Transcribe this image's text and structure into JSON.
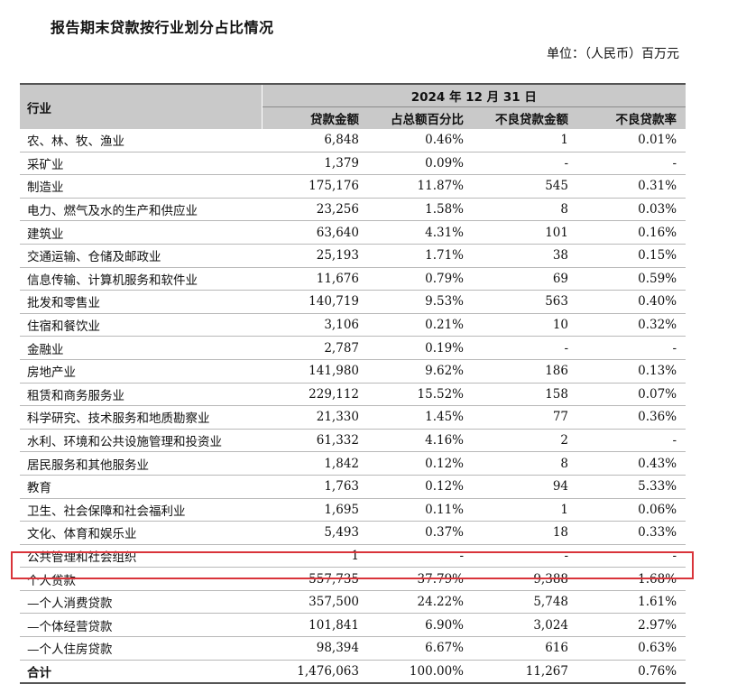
{
  "title": "报告期末贷款按行业划分占比情况",
  "unit": "单位：（人民币）百万元",
  "header": {
    "industry": "行业",
    "date": "2024 年 12 月 31 日",
    "columns": [
      "贷款金额",
      "占总额百分比",
      "不良贷款金额",
      "不良贷款率"
    ]
  },
  "rows": [
    {
      "name": "农、林、牧、渔业",
      "amount": "6,848",
      "pct": "0.46%",
      "npl": "1",
      "nplr": "0.01%"
    },
    {
      "name": "采矿业",
      "amount": "1,379",
      "pct": "0.09%",
      "npl": "-",
      "nplr": "-"
    },
    {
      "name": "制造业",
      "amount": "175,176",
      "pct": "11.87%",
      "npl": "545",
      "nplr": "0.31%"
    },
    {
      "name": "电力、燃气及水的生产和供应业",
      "amount": "23,256",
      "pct": "1.58%",
      "npl": "8",
      "nplr": "0.03%"
    },
    {
      "name": "建筑业",
      "amount": "63,640",
      "pct": "4.31%",
      "npl": "101",
      "nplr": "0.16%"
    },
    {
      "name": "交通运输、仓储及邮政业",
      "amount": "25,193",
      "pct": "1.71%",
      "npl": "38",
      "nplr": "0.15%"
    },
    {
      "name": "信息传输、计算机服务和软件业",
      "amount": "11,676",
      "pct": "0.79%",
      "npl": "69",
      "nplr": "0.59%"
    },
    {
      "name": "批发和零售业",
      "amount": "140,719",
      "pct": "9.53%",
      "npl": "563",
      "nplr": "0.40%"
    },
    {
      "name": "住宿和餐饮业",
      "amount": "3,106",
      "pct": "0.21%",
      "npl": "10",
      "nplr": "0.32%"
    },
    {
      "name": "金融业",
      "amount": "2,787",
      "pct": "0.19%",
      "npl": "-",
      "nplr": "-"
    },
    {
      "name": "房地产业",
      "amount": "141,980",
      "pct": "9.62%",
      "npl": "186",
      "nplr": "0.13%"
    },
    {
      "name": "租赁和商务服务业",
      "amount": "229,112",
      "pct": "15.52%",
      "npl": "158",
      "nplr": "0.07%"
    },
    {
      "name": "科学研究、技术服务和地质勘察业",
      "amount": "21,330",
      "pct": "1.45%",
      "npl": "77",
      "nplr": "0.36%"
    },
    {
      "name": "水利、环境和公共设施管理和投资业",
      "amount": "61,332",
      "pct": "4.16%",
      "npl": "2",
      "nplr": "-"
    },
    {
      "name": "居民服务和其他服务业",
      "amount": "1,842",
      "pct": "0.12%",
      "npl": "8",
      "nplr": "0.43%"
    },
    {
      "name": "教育",
      "amount": "1,763",
      "pct": "0.12%",
      "npl": "94",
      "nplr": "5.33%"
    },
    {
      "name": "卫生、社会保障和社会福利业",
      "amount": "1,695",
      "pct": "0.11%",
      "npl": "1",
      "nplr": "0.06%"
    },
    {
      "name": "文化、体育和娱乐业",
      "amount": "5,493",
      "pct": "0.37%",
      "npl": "18",
      "nplr": "0.33%"
    },
    {
      "name": "公共管理和社会组织",
      "amount": "1",
      "pct": "-",
      "npl": "-",
      "nplr": "-"
    },
    {
      "name": "个人贷款",
      "amount": "557,735",
      "pct": "37.79%",
      "npl": "9,388",
      "nplr": "1.68%"
    },
    {
      "name": "—个人消费贷款",
      "amount": "357,500",
      "pct": "24.22%",
      "npl": "5,748",
      "nplr": "1.61%"
    },
    {
      "name": "—个体经营贷款",
      "amount": "101,841",
      "pct": "6.90%",
      "npl": "3,024",
      "nplr": "2.97%"
    },
    {
      "name": "—个人住房贷款",
      "amount": "98,394",
      "pct": "6.67%",
      "npl": "616",
      "nplr": "0.63%"
    }
  ],
  "total": {
    "name": "合计",
    "amount": "1,476,063",
    "pct": "100.00%",
    "npl": "11,267",
    "nplr": "0.76%"
  },
  "highlight_color": "#d9343a"
}
